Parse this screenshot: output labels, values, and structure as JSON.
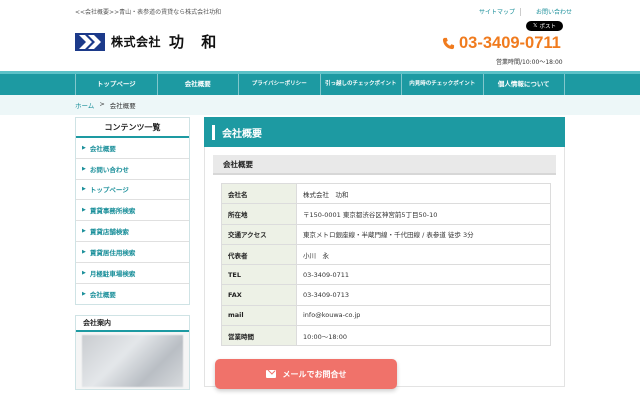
{
  "header": {
    "tagline": "<<会社概要>>青山・表参道の賃貸なら株式会社功和",
    "util_links": [
      "サイトマップ",
      "お問い合わせ"
    ],
    "post_button": "ポスト",
    "post_button_icon": "x-logo-icon",
    "logo_prefix": "株式会社",
    "logo_name": "功 和",
    "phone": "03-3409-0711",
    "phone_icon": "phone-icon",
    "hours": "営業時間/10:00〜18:00",
    "accent_color": "#f07b1e"
  },
  "nav": {
    "items": [
      "トップページ",
      "会社概要",
      "プライバシーポリシー",
      "引っ越しのチェックポイント",
      "内見時のチェックポイント",
      "個人情報について"
    ],
    "bg_color": "#1d9aa2"
  },
  "breadcrumb": {
    "home": "ホーム",
    "separator": ">",
    "current": "会社概要"
  },
  "sidebar": {
    "contents_title": "コンテンツ一覧",
    "items": [
      "会社概要",
      "お問い合わせ",
      "トップページ",
      "賃貸事務所検索",
      "賃貸店舗検索",
      "賃貸居住用検索",
      "月極駐車場検索",
      "会社概要"
    ],
    "company_title": "会社案内"
  },
  "main": {
    "title": "会社概要",
    "subtitle": "会社概要",
    "rows": [
      {
        "label": "会社名",
        "value": "株式会社　功和"
      },
      {
        "label": "所在地",
        "value": "〒150-0001 東京都渋谷区神宮前5丁目50-10"
      },
      {
        "label": "交通アクセス",
        "value": "東京メトロ銀座線・半蔵門線・千代田線 / 表参道 徒歩 3分"
      },
      {
        "label": "代表者",
        "value": "小川　永"
      },
      {
        "label": "TEL",
        "value": "03-3409-0711"
      },
      {
        "label": "FAX",
        "value": "03-3409-0713"
      },
      {
        "label": "mail",
        "value": "info@kouwa-co.jp"
      },
      {
        "label": "営業時間",
        "value": "10:00〜18:00"
      }
    ]
  },
  "floating": {
    "mail_button": "メールでお問合せ",
    "mail_icon": "envelope-icon",
    "color": "#f0726a"
  }
}
